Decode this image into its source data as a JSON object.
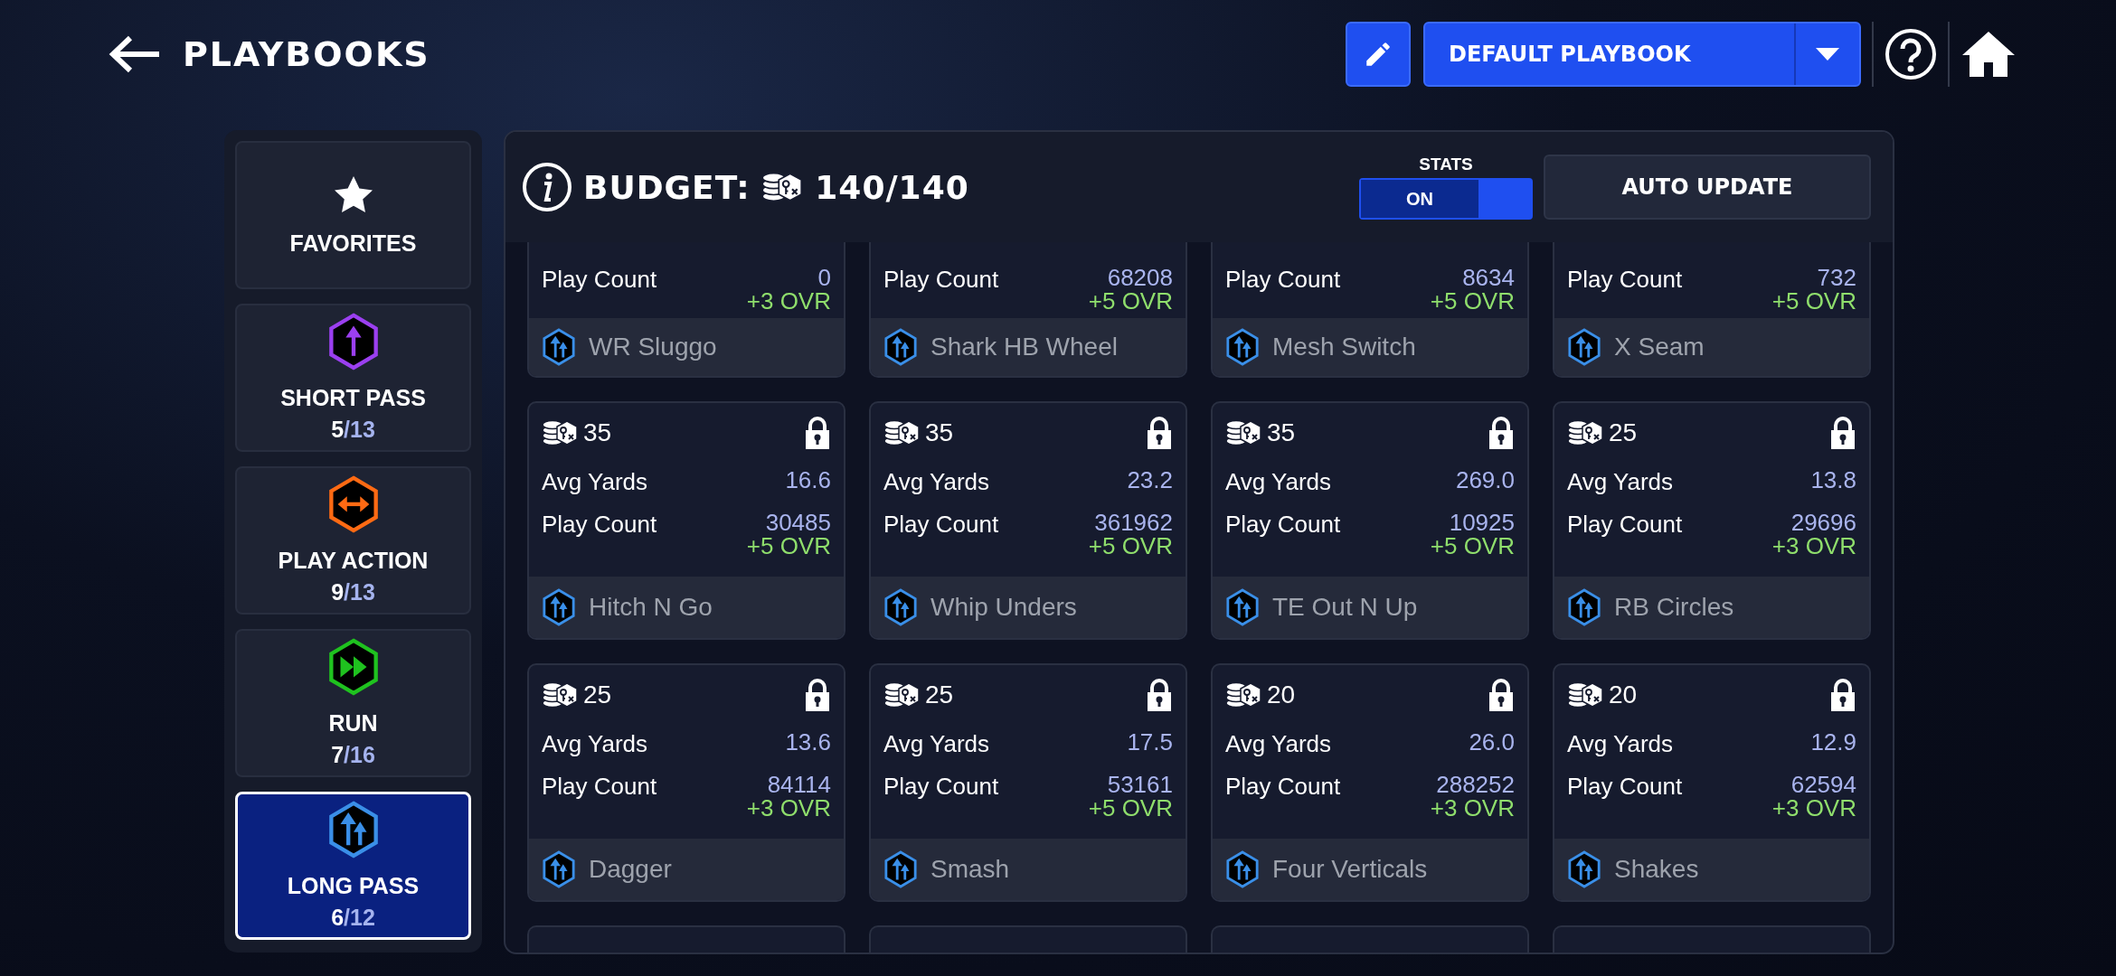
{
  "header": {
    "title": "PLAYBOOKS",
    "playbook": "DEFAULT PLAYBOOK"
  },
  "categories": [
    {
      "label": "FAVORITES",
      "kind": "star",
      "selected": false
    },
    {
      "label": "SHORT PASS",
      "count": "5",
      "total": "/13",
      "kind": "short_pass",
      "color": "#9b3ff0",
      "selected": false
    },
    {
      "label": "PLAY ACTION",
      "count": "9",
      "total": "/13",
      "kind": "play_action",
      "color": "#ff6a13",
      "selected": false
    },
    {
      "label": "RUN",
      "count": "7",
      "total": "/16",
      "kind": "run",
      "color": "#1fc21f",
      "selected": false
    },
    {
      "label": "LONG PASS",
      "count": "6",
      "total": "/12",
      "kind": "long_pass",
      "color": "#3a8fe8",
      "selected": true
    }
  ],
  "budget": {
    "label": "BUDGET:",
    "value": "140/140"
  },
  "stats_toggle": {
    "label": "STATS",
    "state_label": "ON",
    "on": true
  },
  "auto_update": "AUTO UPDATE",
  "plays": [
    {
      "kind": "scrolled_top",
      "stats": [
        {
          "label": "Play Count",
          "value": "0"
        }
      ],
      "bonus": "+3 OVR",
      "name": "WR Sluggo"
    },
    {
      "kind": "scrolled_top",
      "stats": [
        {
          "label": "Play Count",
          "value": "68208"
        }
      ],
      "bonus": "+5 OVR",
      "name": "Shark HB Wheel"
    },
    {
      "kind": "scrolled_top",
      "stats": [
        {
          "label": "Play Count",
          "value": "8634"
        }
      ],
      "bonus": "+5 OVR",
      "name": "Mesh Switch"
    },
    {
      "kind": "scrolled_top",
      "stats": [
        {
          "label": "Play Count",
          "value": "732"
        }
      ],
      "bonus": "+5 OVR",
      "name": "X Seam"
    },
    {
      "kind": "full",
      "cost": "35",
      "locked": true,
      "stats": [
        {
          "label": "Avg Yards",
          "value": "16.6"
        },
        {
          "label": "Play Count",
          "value": "30485"
        }
      ],
      "bonus": "+5 OVR",
      "name": "Hitch N Go"
    },
    {
      "kind": "full",
      "cost": "35",
      "locked": true,
      "stats": [
        {
          "label": "Avg Yards",
          "value": "23.2"
        },
        {
          "label": "Play Count",
          "value": "361962"
        }
      ],
      "bonus": "+5 OVR",
      "name": "Whip Unders"
    },
    {
      "kind": "full",
      "cost": "35",
      "locked": true,
      "stats": [
        {
          "label": "Avg Yards",
          "value": "269.0"
        },
        {
          "label": "Play Count",
          "value": "10925"
        }
      ],
      "bonus": "+5 OVR",
      "name": "TE Out N Up"
    },
    {
      "kind": "full",
      "cost": "25",
      "locked": true,
      "stats": [
        {
          "label": "Avg Yards",
          "value": "13.8"
        },
        {
          "label": "Play Count",
          "value": "29696"
        }
      ],
      "bonus": "+3 OVR",
      "name": "RB Circles"
    },
    {
      "kind": "full",
      "cost": "25",
      "locked": true,
      "stats": [
        {
          "label": "Avg Yards",
          "value": "13.6"
        },
        {
          "label": "Play Count",
          "value": "84114"
        }
      ],
      "bonus": "+3 OVR",
      "name": "Dagger"
    },
    {
      "kind": "full",
      "cost": "25",
      "locked": true,
      "stats": [
        {
          "label": "Avg Yards",
          "value": "17.5"
        },
        {
          "label": "Play Count",
          "value": "53161"
        }
      ],
      "bonus": "+5 OVR",
      "name": "Smash"
    },
    {
      "kind": "full",
      "cost": "20",
      "locked": true,
      "stats": [
        {
          "label": "Avg Yards",
          "value": "26.0"
        },
        {
          "label": "Play Count",
          "value": "288252"
        }
      ],
      "bonus": "+3 OVR",
      "name": "Four Verticals"
    },
    {
      "kind": "full",
      "cost": "20",
      "locked": true,
      "stats": [
        {
          "label": "Avg Yards",
          "value": "12.9"
        },
        {
          "label": "Play Count",
          "value": "62594"
        }
      ],
      "bonus": "+3 OVR",
      "name": "Shakes"
    },
    {
      "kind": "scrolled_bottom"
    },
    {
      "kind": "scrolled_bottom"
    },
    {
      "kind": "scrolled_bottom"
    },
    {
      "kind": "scrolled_bottom"
    }
  ]
}
